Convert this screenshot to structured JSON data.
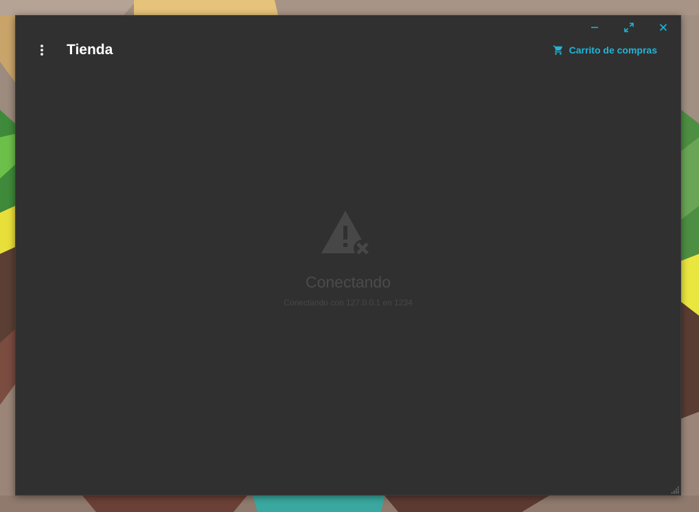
{
  "window": {
    "title": "Tienda",
    "controls": {
      "minimize_icon": "minimize-icon",
      "maximize_icon": "maximize-icon",
      "close_icon": "close-icon"
    }
  },
  "header": {
    "menu_icon": "more-vert-icon",
    "cart": {
      "label": "Carrito de compras",
      "icon": "shopping-cart-icon"
    }
  },
  "status": {
    "icon": "warning-disconnected-icon",
    "title": "Conectando",
    "message": "Conectando con 127.0.0.1 en 1234"
  },
  "colors": {
    "accent": "#1fb6d8",
    "window_bg": "#303030",
    "title_text": "#ffffff",
    "status_text": "#4b4b4b"
  }
}
